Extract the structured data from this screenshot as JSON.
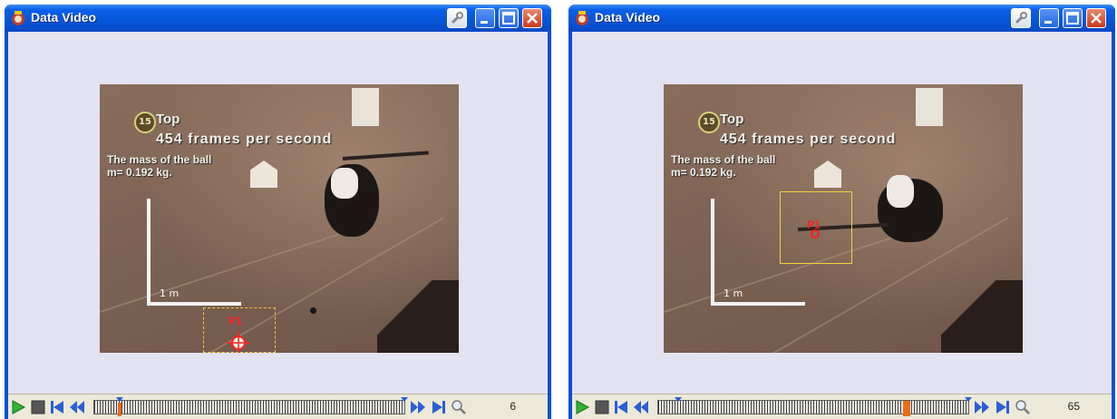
{
  "windows": [
    {
      "id": "left",
      "title": "Data Video",
      "overlay": {
        "top_badge": "15",
        "top_text": "Top",
        "fps_text": "454  frames  per  second",
        "mass_line1": "The mass of the ball",
        "mass_line2": "m= 0.192 kg.",
        "scale_label": "1 m",
        "point_label": "P1"
      },
      "frame_number": "6",
      "playhead_fraction": 0.02
    },
    {
      "id": "right",
      "title": "Data Video",
      "overlay": {
        "top_badge": "15",
        "top_text": "Top",
        "fps_text": "454  frames  per  second",
        "mass_line1": "The mass of the ball",
        "mass_line2": "m= 0.192 kg.",
        "scale_label": "1 m",
        "point_label": "P1"
      },
      "frame_number": "65",
      "playhead_fraction": 0.77
    }
  ],
  "icons": {
    "app": "data-video-app-icon",
    "tool": "wrench-icon",
    "minimize": "minimize-icon",
    "maximize": "maximize-icon",
    "close": "close-icon",
    "play": "play-icon",
    "stop": "stop-icon",
    "first": "skip-to-start-icon",
    "step_back": "step-back-icon",
    "step_forward": "step-forward-icon",
    "last": "skip-to-end-icon",
    "zoom": "zoom-icon"
  },
  "colors": {
    "title_bar": "#0a5fe8",
    "client_bg": "#e3e2f0",
    "marker_red": "#ff2020",
    "select_box": "#f2d23c"
  }
}
